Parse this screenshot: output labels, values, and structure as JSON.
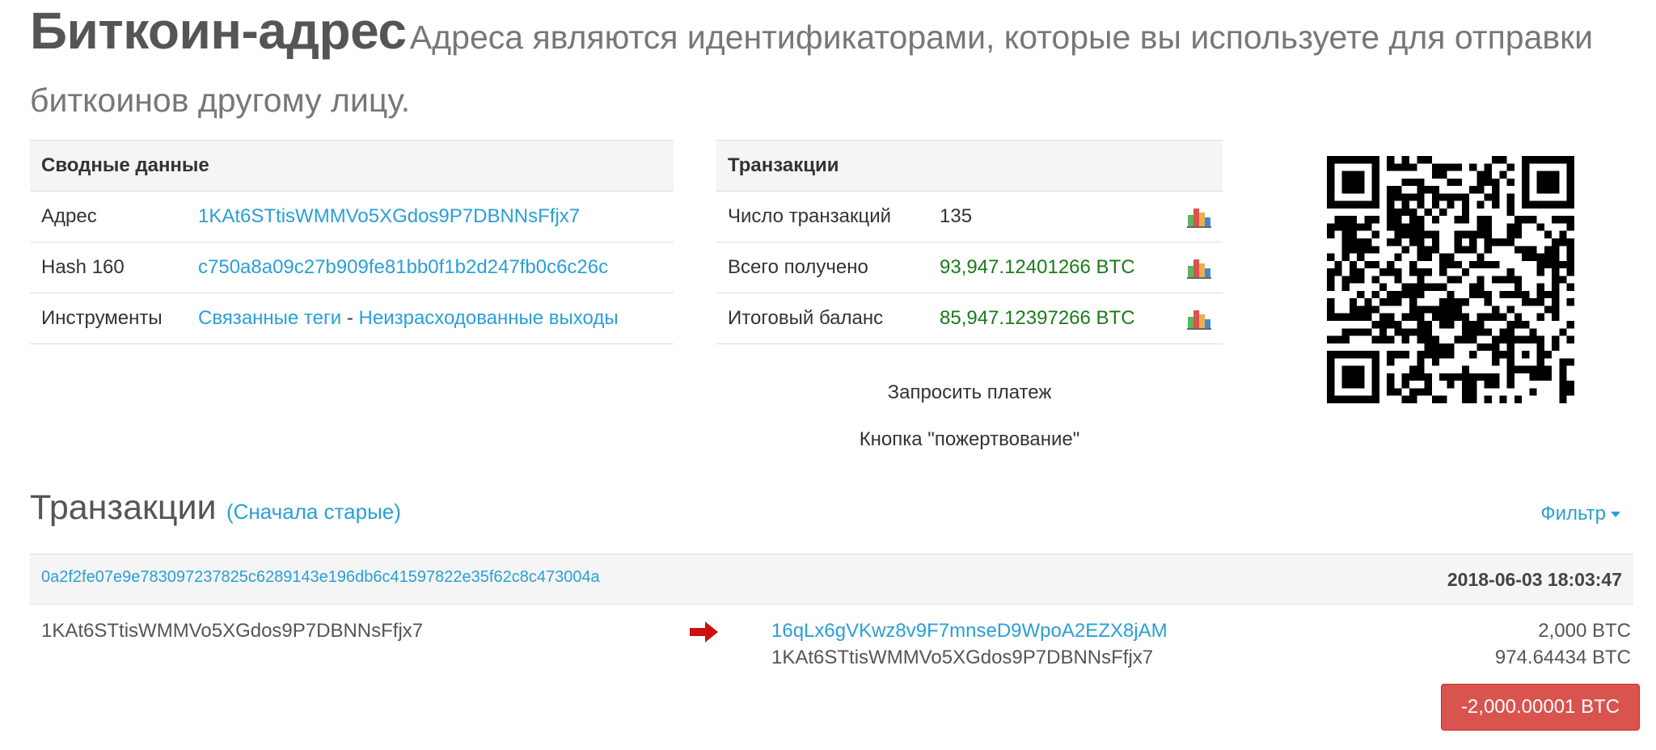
{
  "header": {
    "title": "Биткоин-адрес",
    "subtitle": "Адреса являются идентификаторами, которые вы используете для отправки биткоинов другому лицу."
  },
  "summary": {
    "heading": "Сводные данные",
    "address_label": "Адрес",
    "address_value": "1KAt6STtisWMMVo5XGdos9P7DBNNsFfjx7",
    "hash_label": "Hash 160",
    "hash_value": "c750a8a09c27b909fe81bb0f1b2d247fb0c6c26c",
    "tools_label": "Инструменты",
    "tools_link1": "Связанные теги",
    "tools_separator": "-",
    "tools_link2": "Неизрасходованные выходы"
  },
  "transactions_summary": {
    "heading": "Транзакции",
    "count_label": "Число транзакций",
    "count_value": "135",
    "received_label": "Всего получено",
    "received_value": "93,947.12401266 BTC",
    "balance_label": "Итоговый баланс",
    "balance_value": "85,947.12397266 BTC",
    "chart_icon": "bar-chart-icon"
  },
  "actions": {
    "request_payment": "Запросить платеж",
    "donate_button": "Кнопка \"пожертвование\""
  },
  "qr": {
    "icon": "qr-code"
  },
  "transactions": {
    "heading": "Транзакции",
    "sort_label": "(Сначала старые)",
    "filter_label": "Фильтр",
    "items": [
      {
        "hash": "0a2f2fe07e9e783097237825c6289143e196db6c41597822e35f62c8c473004a",
        "time": "2018-06-03 18:03:47",
        "from": "1KAt6STtisWMMVo5XGdos9P7DBNNsFfjx7",
        "outputs": [
          {
            "address": "16qLx6gVKwz8v9F7mnseD9WpoA2EZX8jAM",
            "amount": "2,000 BTC"
          },
          {
            "address": "1KAt6STtisWMMVo5XGdos9P7DBNNsFfjx7",
            "amount": "974.64434 BTC"
          }
        ],
        "total": "-2,000.00001 BTC"
      }
    ]
  },
  "colors": {
    "link": "#2a9fd6",
    "positive": "#1b7a1b",
    "danger": "#d9534f",
    "arrow": "#cc1111"
  }
}
